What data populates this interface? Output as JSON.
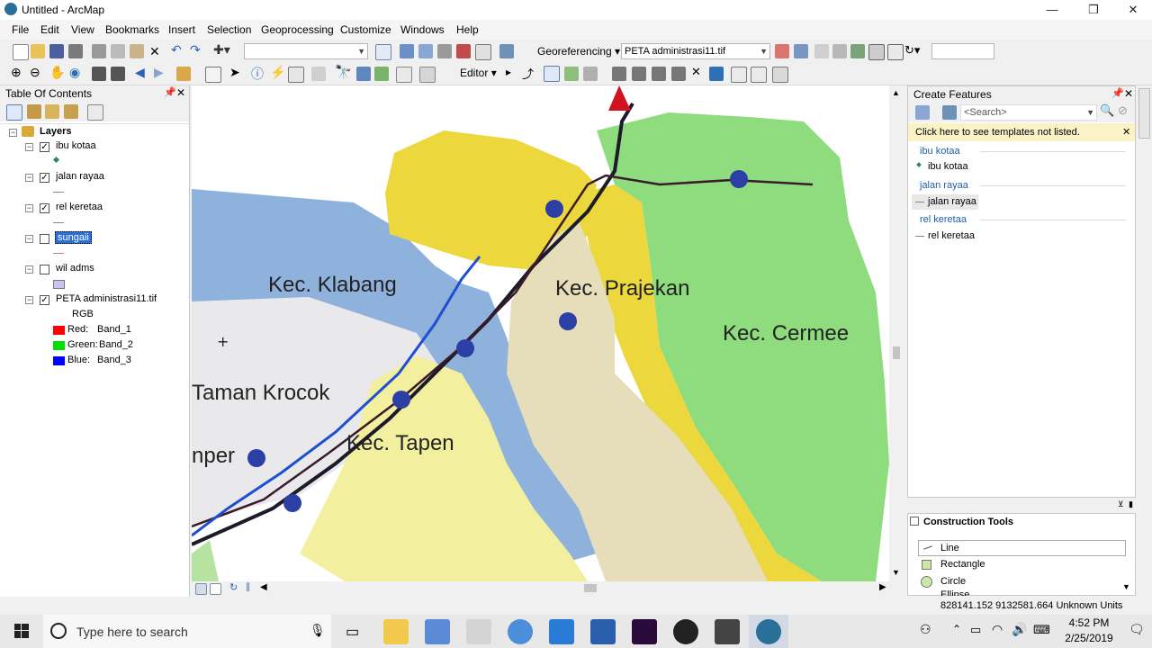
{
  "window": {
    "title": "Untitled - ArcMap",
    "minimize": "—",
    "maximize": "❐",
    "close": "✕"
  },
  "menu": [
    "File",
    "Edit",
    "View",
    "Bookmarks",
    "Insert",
    "Selection",
    "Geoprocessing",
    "Customize",
    "Windows",
    "Help"
  ],
  "toolbar": {
    "scale_value": "",
    "georef_label": "Georeferencing",
    "georef_layer": "PETA administrasi11.tif",
    "editor_label": "Editor"
  },
  "toc": {
    "title": "Table Of Contents",
    "root": "Layers",
    "layers": [
      {
        "name": "ibu kotaa",
        "checked": true
      },
      {
        "name": "jalan rayaa",
        "checked": true
      },
      {
        "name": "rel keretaa",
        "checked": true
      },
      {
        "name": "sungaii",
        "checked": false,
        "selected": true
      },
      {
        "name": "wil adms",
        "checked": false
      },
      {
        "name": "PETA administrasi11.tif",
        "checked": true
      }
    ],
    "raster": {
      "rgb": "RGB",
      "bands": [
        {
          "label": "Red:",
          "band": "Band_1",
          "color": "#ff0000"
        },
        {
          "label": "Green:",
          "band": "Band_2",
          "color": "#00e000"
        },
        {
          "label": "Blue:",
          "band": "Band_3",
          "color": "#0000ff"
        }
      ]
    }
  },
  "map": {
    "labels": [
      "Kec. Klabang",
      "Kec. Prajekan",
      "Kec. Cermee",
      "Taman Krocok",
      "Kec. Tapen",
      "nper"
    ]
  },
  "create_features": {
    "title": "Create Features",
    "search_placeholder": "<Search>",
    "hint": "Click here to see templates not listed.",
    "groups": [
      {
        "title": "ibu kotaa",
        "item": "ibu kotaa"
      },
      {
        "title": "jalan rayaa",
        "item": "jalan rayaa"
      },
      {
        "title": "rel keretaa",
        "item": "rel keretaa"
      }
    ]
  },
  "construction_tools": {
    "title": "Construction Tools",
    "tools": [
      "Line",
      "Rectangle",
      "Circle",
      "Ellipse"
    ]
  },
  "status": {
    "coords": "828141.152  9132581.664 Unknown Units"
  },
  "taskbar": {
    "search_placeholder": "Type here to search",
    "time": "4:52 PM",
    "date": "2/25/2019"
  }
}
